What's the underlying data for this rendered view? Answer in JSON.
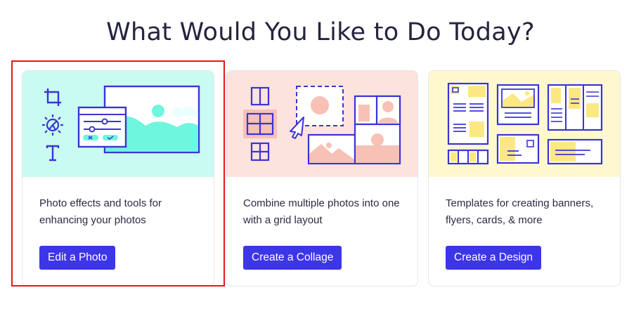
{
  "page": {
    "title": "What Would You Like to Do Today?"
  },
  "cards": [
    {
      "id": "edit-photo",
      "description": "Photo effects and tools for enhancing your photos",
      "button_label": "Edit a Photo",
      "art_color": "#c9fbf3",
      "selected": true
    },
    {
      "id": "collage",
      "description": "Combine multiple photos into one with a grid layout",
      "button_label": "Create a Collage",
      "art_color": "#fde3dd",
      "selected": false
    },
    {
      "id": "design",
      "description": "Templates for creating banners, flyers, cards, & more",
      "button_label": "Create a Design",
      "art_color": "#fff8cf",
      "selected": false
    }
  ],
  "colors": {
    "accent": "#3d35e8",
    "illustration_stroke": "#3b34d6",
    "selection_outline": "#e3171f"
  }
}
